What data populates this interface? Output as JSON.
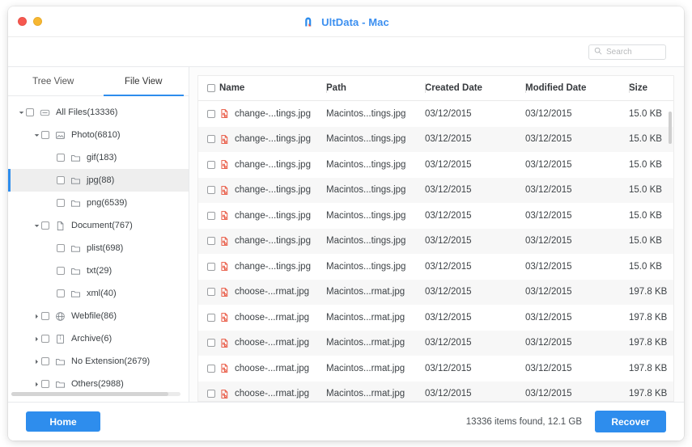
{
  "window": {
    "title": "UltData - Mac",
    "accent_color": "#2e8ded",
    "logo_icon": "ultdata-logo-icon",
    "traffic_lights": [
      {
        "name": "close",
        "color": "#f6584f"
      },
      {
        "name": "minimize",
        "color": "#f7b731"
      }
    ]
  },
  "search": {
    "placeholder": "Search",
    "value": "",
    "icon": "search-icon"
  },
  "sidebar": {
    "tabs": [
      {
        "label": "Tree View",
        "active": false
      },
      {
        "label": "File View",
        "active": true
      }
    ],
    "tree": [
      {
        "label": "All Files(13336)",
        "depth": 0,
        "arrow": "down",
        "icon": "harddisk-icon",
        "selected": false
      },
      {
        "label": "Photo(6810)",
        "depth": 1,
        "arrow": "down",
        "icon": "photo-icon",
        "selected": false
      },
      {
        "label": "gif(183)",
        "depth": 2,
        "arrow": "none",
        "icon": "folder-icon",
        "selected": false
      },
      {
        "label": "jpg(88)",
        "depth": 2,
        "arrow": "none",
        "icon": "folder-icon",
        "selected": true
      },
      {
        "label": "png(6539)",
        "depth": 2,
        "arrow": "none",
        "icon": "folder-icon",
        "selected": false
      },
      {
        "label": "Document(767)",
        "depth": 1,
        "arrow": "down",
        "icon": "document-icon",
        "selected": false
      },
      {
        "label": "plist(698)",
        "depth": 2,
        "arrow": "none",
        "icon": "folder-icon",
        "selected": false
      },
      {
        "label": "txt(29)",
        "depth": 2,
        "arrow": "none",
        "icon": "folder-icon",
        "selected": false
      },
      {
        "label": "xml(40)",
        "depth": 2,
        "arrow": "none",
        "icon": "folder-icon",
        "selected": false
      },
      {
        "label": "Webfile(86)",
        "depth": 1,
        "arrow": "right",
        "icon": "globe-icon",
        "selected": false
      },
      {
        "label": "Archive(6)",
        "depth": 1,
        "arrow": "right",
        "icon": "archive-icon",
        "selected": false
      },
      {
        "label": "No Extension(2679)",
        "depth": 1,
        "arrow": "right",
        "icon": "folder-icon",
        "selected": false
      },
      {
        "label": "Others(2988)",
        "depth": 1,
        "arrow": "right",
        "icon": "folder-icon",
        "selected": false
      }
    ]
  },
  "table": {
    "columns": [
      "Name",
      "Path",
      "Created Date",
      "Modified Date",
      "Size"
    ],
    "rows": [
      {
        "name": "change-...tings.jpg",
        "path": "Macintos...tings.jpg",
        "created": "03/12/2015",
        "modified": "03/12/2015",
        "size": "15.0 KB"
      },
      {
        "name": "change-...tings.jpg",
        "path": "Macintos...tings.jpg",
        "created": "03/12/2015",
        "modified": "03/12/2015",
        "size": "15.0 KB"
      },
      {
        "name": "change-...tings.jpg",
        "path": "Macintos...tings.jpg",
        "created": "03/12/2015",
        "modified": "03/12/2015",
        "size": "15.0 KB"
      },
      {
        "name": "change-...tings.jpg",
        "path": "Macintos...tings.jpg",
        "created": "03/12/2015",
        "modified": "03/12/2015",
        "size": "15.0 KB"
      },
      {
        "name": "change-...tings.jpg",
        "path": "Macintos...tings.jpg",
        "created": "03/12/2015",
        "modified": "03/12/2015",
        "size": "15.0 KB"
      },
      {
        "name": "change-...tings.jpg",
        "path": "Macintos...tings.jpg",
        "created": "03/12/2015",
        "modified": "03/12/2015",
        "size": "15.0 KB"
      },
      {
        "name": "change-...tings.jpg",
        "path": "Macintos...tings.jpg",
        "created": "03/12/2015",
        "modified": "03/12/2015",
        "size": "15.0 KB"
      },
      {
        "name": "choose-...rmat.jpg",
        "path": "Macintos...rmat.jpg",
        "created": "03/12/2015",
        "modified": "03/12/2015",
        "size": "197.8 KB"
      },
      {
        "name": "choose-...rmat.jpg",
        "path": "Macintos...rmat.jpg",
        "created": "03/12/2015",
        "modified": "03/12/2015",
        "size": "197.8 KB"
      },
      {
        "name": "choose-...rmat.jpg",
        "path": "Macintos...rmat.jpg",
        "created": "03/12/2015",
        "modified": "03/12/2015",
        "size": "197.8 KB"
      },
      {
        "name": "choose-...rmat.jpg",
        "path": "Macintos...rmat.jpg",
        "created": "03/12/2015",
        "modified": "03/12/2015",
        "size": "197.8 KB"
      },
      {
        "name": "choose-...rmat.jpg",
        "path": "Macintos...rmat.jpg",
        "created": "03/12/2015",
        "modified": "03/12/2015",
        "size": "197.8 KB"
      }
    ]
  },
  "footer": {
    "home_label": "Home",
    "status": "13336 items found, 12.1 GB",
    "recover_label": "Recover"
  }
}
